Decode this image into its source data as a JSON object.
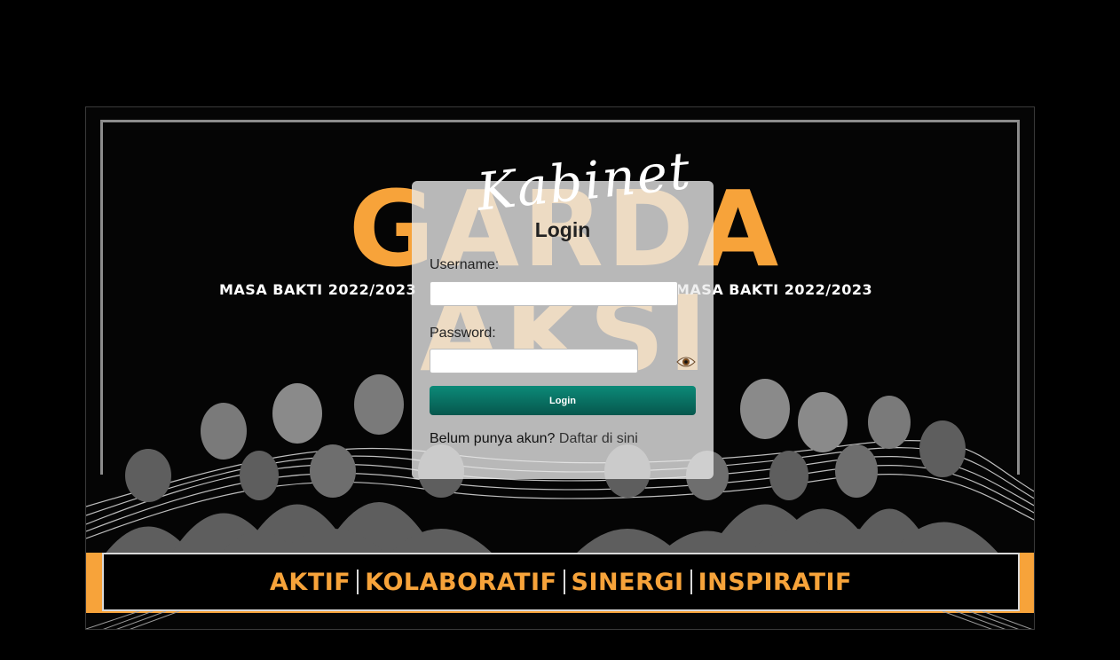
{
  "banner": {
    "script_title": "Kabinet",
    "main_title": "GARDA AKSI",
    "period_left": "MASA BAKTI 2022/2023",
    "period_right": "MASA BAKTI 2022/2023",
    "motto": [
      "AKTIF",
      "KOLABORATIF",
      "SINERGI",
      "INSPIRATIF"
    ],
    "accent_color": "#f7a33a"
  },
  "login": {
    "title": "Login",
    "username_label": "Username:",
    "username_value": "",
    "password_label": "Password:",
    "password_value": "",
    "show_password_icon": "eye-icon",
    "submit_label": "Login",
    "register_prompt": "Belum punya akun?",
    "register_link": "Daftar di sini",
    "button_color": "#0a7a6a"
  }
}
